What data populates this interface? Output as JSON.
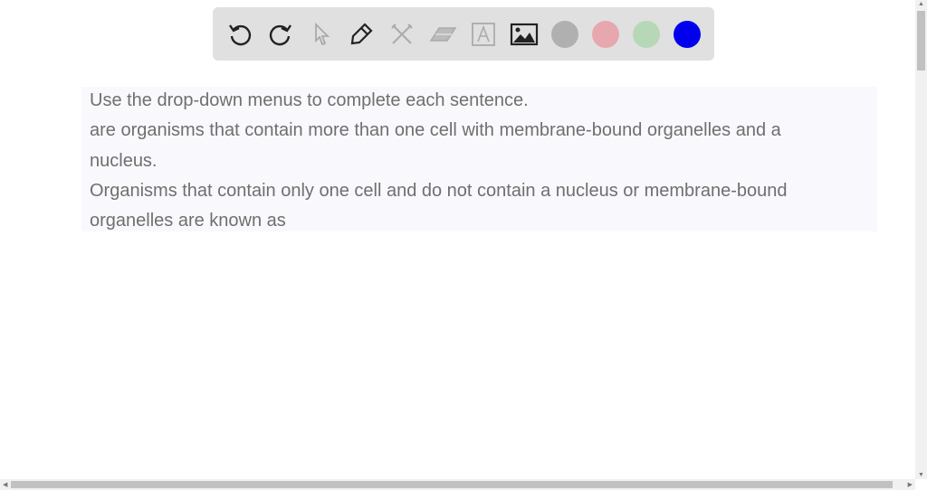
{
  "toolbar": {
    "tools": [
      "undo-icon",
      "redo-icon",
      "select-icon",
      "pen-icon",
      "tools-icon",
      "eraser-icon",
      "text-icon",
      "image-icon"
    ],
    "colors": [
      "#b0b0b0",
      "#e6a8ae",
      "#b6d8b6",
      "#0000ee"
    ]
  },
  "content": {
    "lines": [
      "Use the drop-down menus to complete each sentence.",
      "are organisms that contain more than one cell with membrane-bound organelles and a",
      "nucleus.",
      "Organisms that contain only one cell and do not contain a nucleus or membrane-bound",
      "organelles are known as"
    ]
  }
}
